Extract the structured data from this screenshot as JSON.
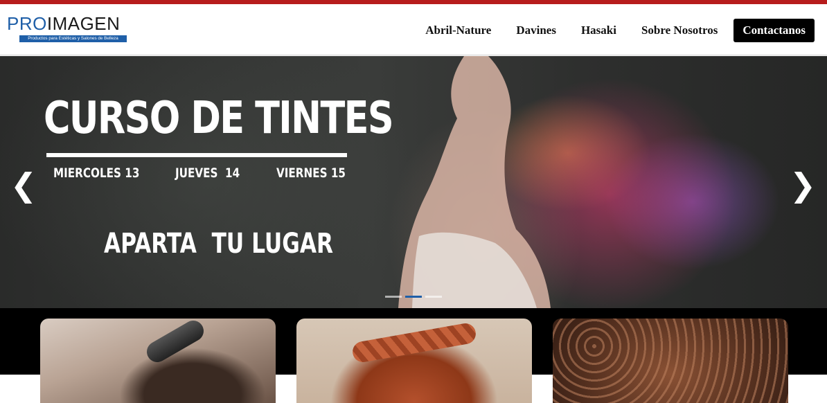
{
  "brand": {
    "logo_pro": "PRO",
    "logo_imagen": "IMAGEN",
    "tagline": "Productos para Estéticas y Salones de Belleza",
    "accent_color": "#1f5fa8",
    "top_bar_color": "#b71c1c"
  },
  "nav": {
    "items": [
      {
        "label": "Abril-Nature"
      },
      {
        "label": "Davines"
      },
      {
        "label": "Hasaki"
      },
      {
        "label": "Sobre Nosotros"
      }
    ],
    "cta_label": "Contactanos"
  },
  "hero": {
    "title": "CURSO DE TINTES",
    "dates": [
      "MIERCOLES 13",
      "JUEVES  14",
      "VIERNES 15"
    ],
    "cta": "APARTA  TU LUGAR",
    "prev_icon": "chevron-left-icon",
    "next_icon": "chevron-right-icon",
    "prev_glyph": "❮",
    "next_glyph": "❯",
    "slide_count": 3,
    "active_slide": 2
  },
  "cards": [
    {
      "image": "hair-curling-iron-photo"
    },
    {
      "image": "red-braid-photo"
    },
    {
      "image": "wavy-brown-hair-photo"
    }
  ]
}
